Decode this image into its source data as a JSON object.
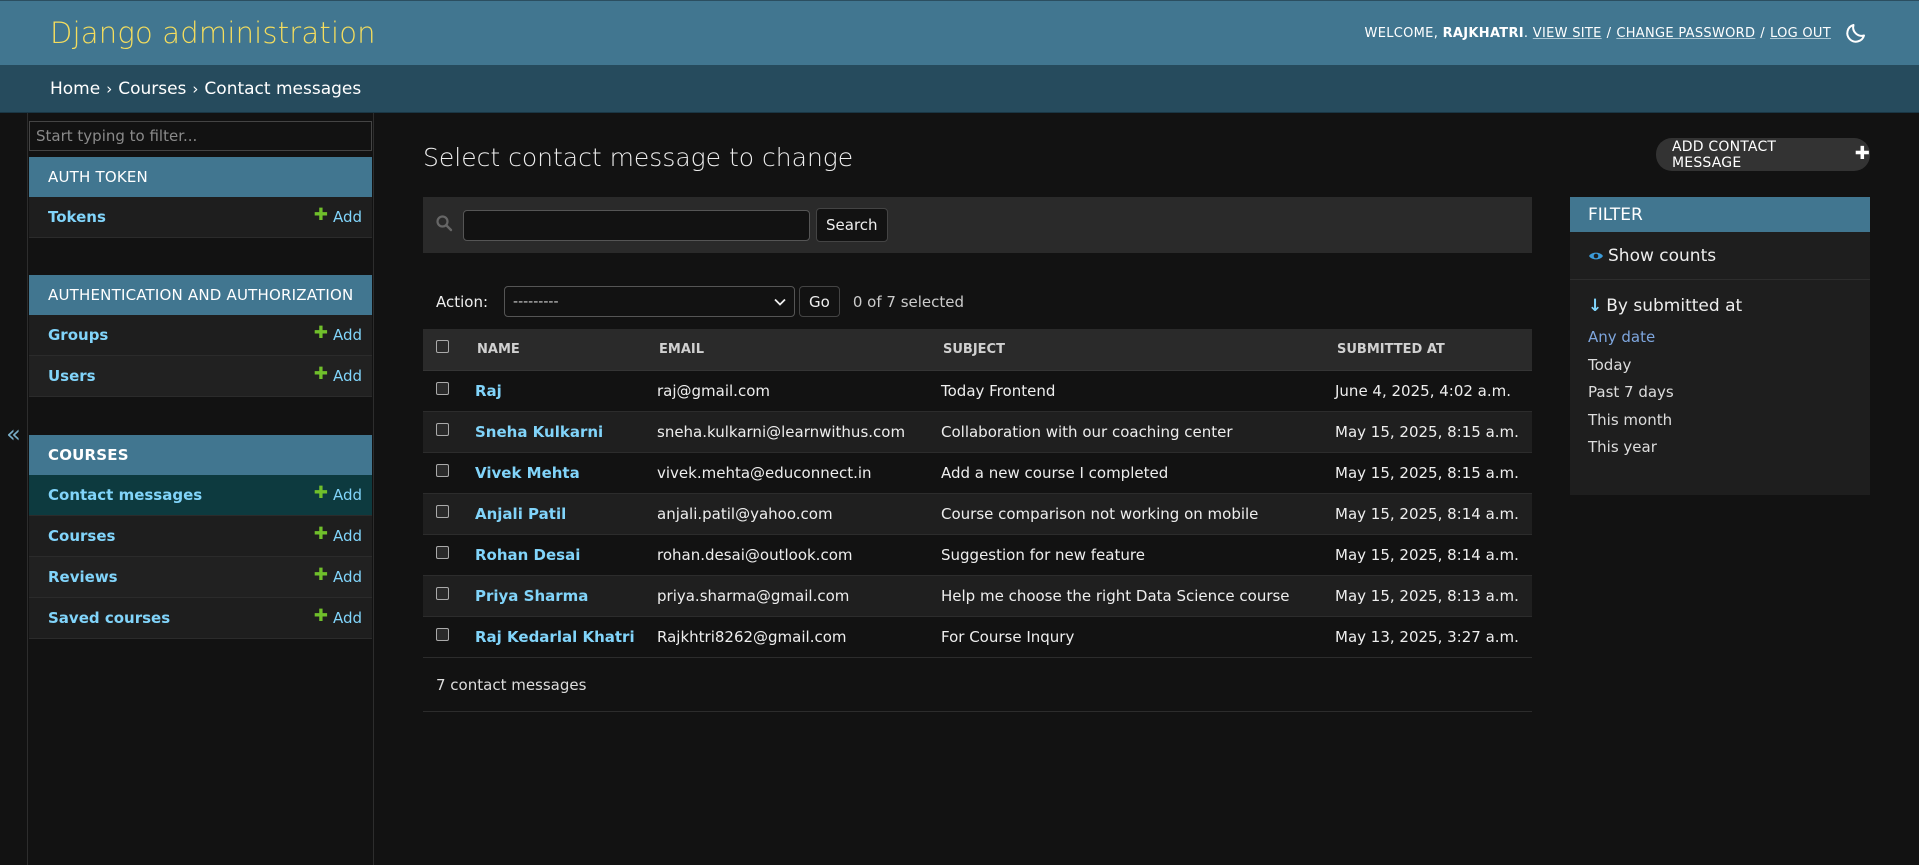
{
  "header": {
    "brand": "Django administration",
    "welcome": "Welcome,",
    "username": "RAJKHATRI",
    "view_site": "View site",
    "change_password": "Change password",
    "log_out": "Log out",
    "sep": "/",
    "dot": ".",
    "theme_icon": "moon-icon"
  },
  "breadcrumbs": {
    "home": "Home",
    "app": "Courses",
    "current": "Contact messages",
    "arrow": "›"
  },
  "sidebar": {
    "collapse_glyph": "«",
    "filter_placeholder": "Start typing to filter...",
    "add_label": "Add",
    "apps": [
      {
        "name": "Auth Token",
        "models": [
          {
            "name": "Tokens"
          }
        ]
      },
      {
        "name": "Authentication and Authorization",
        "models": [
          {
            "name": "Groups"
          },
          {
            "name": "Users"
          }
        ]
      },
      {
        "name": "Courses",
        "models": [
          {
            "name": "Contact messages"
          },
          {
            "name": "Courses"
          },
          {
            "name": "Reviews"
          },
          {
            "name": "Saved courses"
          }
        ]
      }
    ]
  },
  "content": {
    "title": "Select contact message to change",
    "add_button": "Add contact message",
    "search_button": "Search",
    "search_value": "",
    "action_label": "Action:",
    "action_selected": "---------",
    "go_button": "Go",
    "selection_counter": "0 of 7 selected",
    "columns": [
      "Name",
      "Email",
      "Subject",
      "Submitted at"
    ],
    "rows": [
      {
        "name": "Raj",
        "email": "raj@gmail.com",
        "subject": "Today Frontend",
        "submitted_at": "June 4, 2025, 4:02 a.m."
      },
      {
        "name": "Sneha Kulkarni",
        "email": "sneha.kulkarni@learnwithus.com",
        "subject": "Collaboration with our coaching center",
        "submitted_at": "May 15, 2025, 8:15 a.m."
      },
      {
        "name": "Vivek Mehta",
        "email": "vivek.mehta@educonnect.in",
        "subject": "Add a new course I completed",
        "submitted_at": "May 15, 2025, 8:15 a.m."
      },
      {
        "name": "Anjali Patil",
        "email": "anjali.patil@yahoo.com",
        "subject": "Course comparison not working on mobile",
        "submitted_at": "May 15, 2025, 8:14 a.m."
      },
      {
        "name": "Rohan Desai",
        "email": "rohan.desai@outlook.com",
        "subject": "Suggestion for new feature",
        "submitted_at": "May 15, 2025, 8:14 a.m."
      },
      {
        "name": "Priya Sharma",
        "email": "priya.sharma@gmail.com",
        "subject": "Help me choose the right Data Science course",
        "submitted_at": "May 15, 2025, 8:13 a.m."
      },
      {
        "name": "Raj Kedarlal Khatri",
        "email": "Rajkhtri8262@gmail.com",
        "subject": "For Course Inqury",
        "submitted_at": "May 13, 2025, 3:27 a.m."
      }
    ],
    "paginator": "7 contact messages"
  },
  "filter": {
    "heading": "Filter",
    "show_counts": "Show counts",
    "by_title": "By submitted at",
    "options": [
      "Any date",
      "Today",
      "Past 7 days",
      "This month",
      "This year"
    ],
    "selected_option": "Any date"
  },
  "colors": {
    "header_bg": "#417690",
    "breadcrumb_bg": "#264b5d",
    "brand_text": "#f5dd5d",
    "link": "#81d4fa",
    "add_plus": "#70bf2b"
  }
}
